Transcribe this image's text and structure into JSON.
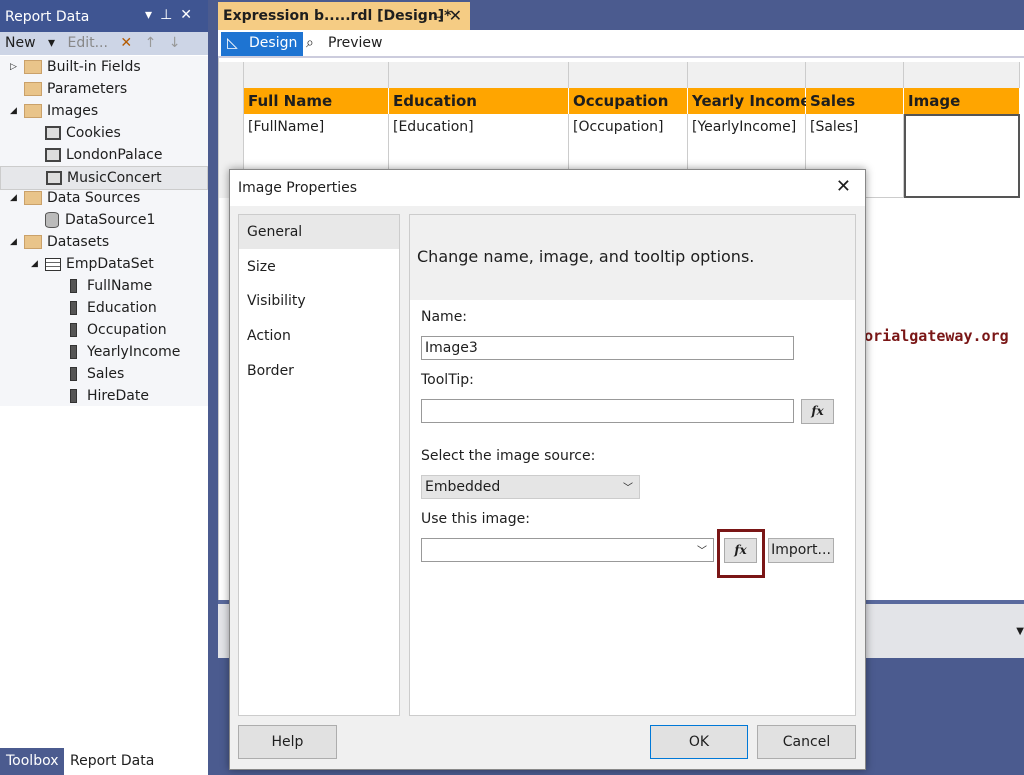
{
  "report_data": {
    "title": "Report Data",
    "toolbar": {
      "new": "New",
      "edit": "Edit..."
    },
    "tree": [
      {
        "label": "Built-in Fields",
        "type": "folder",
        "level": 0,
        "expander": "▷"
      },
      {
        "label": "Parameters",
        "type": "folder",
        "level": 0,
        "expander": ""
      },
      {
        "label": "Images",
        "type": "folder",
        "level": 0,
        "expander": "◢"
      },
      {
        "label": "Cookies",
        "type": "image",
        "level": 1
      },
      {
        "label": "LondonPalace",
        "type": "image",
        "level": 1
      },
      {
        "label": "MusicConcert",
        "type": "image",
        "level": 1,
        "selected": true
      },
      {
        "label": "Data Sources",
        "type": "folder",
        "level": 0,
        "expander": "◢"
      },
      {
        "label": "DataSource1",
        "type": "datasource",
        "level": 1
      },
      {
        "label": "Datasets",
        "type": "folder",
        "level": 0,
        "expander": "◢"
      },
      {
        "label": "EmpDataSet",
        "type": "table",
        "level": 1,
        "expander": "◢"
      },
      {
        "label": "FullName",
        "type": "field",
        "level": 2
      },
      {
        "label": "Education",
        "type": "field",
        "level": 2
      },
      {
        "label": "Occupation",
        "type": "field",
        "level": 2
      },
      {
        "label": "YearlyIncome",
        "type": "field",
        "level": 2
      },
      {
        "label": "Sales",
        "type": "field",
        "level": 2
      },
      {
        "label": "HireDate",
        "type": "field",
        "level": 2
      }
    ],
    "bottom_tabs": [
      "Toolbox",
      "Report Data"
    ]
  },
  "document": {
    "tab_title": "Expression b.....rdl [Design]*",
    "view_tabs": [
      "Design",
      "Preview"
    ],
    "table": {
      "headers": [
        "Full Name",
        "Education",
        "Occupation",
        "Yearly Income",
        "Sales",
        "Image"
      ],
      "cells": [
        "[FullName]",
        "[Education]",
        "[Occupation]",
        "[YearlyIncome]",
        "[Sales]",
        ""
      ]
    }
  },
  "watermark": "©tutorialgateway.org",
  "dialog": {
    "title": "Image Properties",
    "nav": [
      "General",
      "Size",
      "Visibility",
      "Action",
      "Border"
    ],
    "header": "Change name, image, and tooltip options.",
    "name_label": "Name:",
    "name_value": "Image3",
    "tooltip_label": "ToolTip:",
    "tooltip_value": "",
    "source_label": "Select the image source:",
    "source_value": "Embedded",
    "use_label": "Use this image:",
    "use_value": "",
    "fx": "fx",
    "import": "Import...",
    "help": "Help",
    "ok": "OK",
    "cancel": "Cancel"
  },
  "colors": {
    "header_orange": "#ffa500",
    "highlight": "#7a1616",
    "accent": "#3f5592"
  }
}
